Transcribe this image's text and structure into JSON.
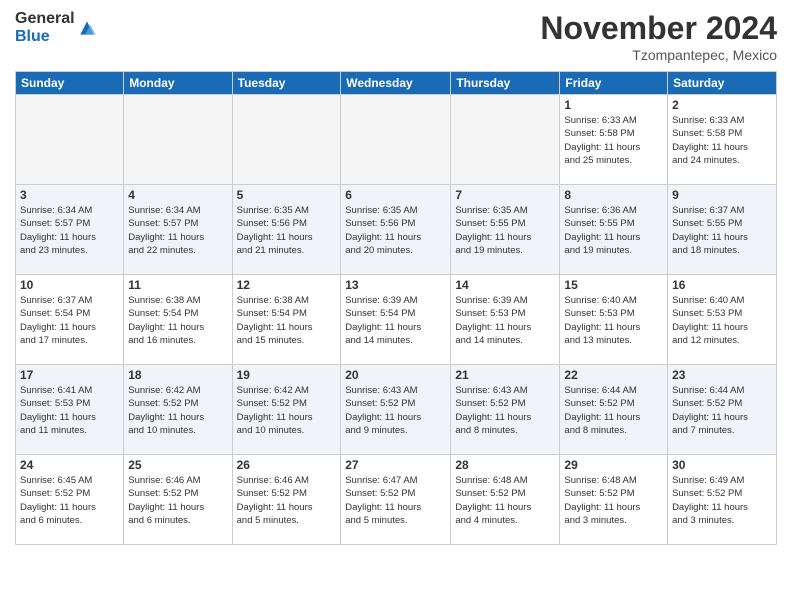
{
  "logo": {
    "general": "General",
    "blue": "Blue"
  },
  "title": "November 2024",
  "location": "Tzompantepec, Mexico",
  "days_header": [
    "Sunday",
    "Monday",
    "Tuesday",
    "Wednesday",
    "Thursday",
    "Friday",
    "Saturday"
  ],
  "weeks": [
    [
      {
        "day": "",
        "info": ""
      },
      {
        "day": "",
        "info": ""
      },
      {
        "day": "",
        "info": ""
      },
      {
        "day": "",
        "info": ""
      },
      {
        "day": "",
        "info": ""
      },
      {
        "day": "1",
        "info": "Sunrise: 6:33 AM\nSunset: 5:58 PM\nDaylight: 11 hours\nand 25 minutes."
      },
      {
        "day": "2",
        "info": "Sunrise: 6:33 AM\nSunset: 5:58 PM\nDaylight: 11 hours\nand 24 minutes."
      }
    ],
    [
      {
        "day": "3",
        "info": "Sunrise: 6:34 AM\nSunset: 5:57 PM\nDaylight: 11 hours\nand 23 minutes."
      },
      {
        "day": "4",
        "info": "Sunrise: 6:34 AM\nSunset: 5:57 PM\nDaylight: 11 hours\nand 22 minutes."
      },
      {
        "day": "5",
        "info": "Sunrise: 6:35 AM\nSunset: 5:56 PM\nDaylight: 11 hours\nand 21 minutes."
      },
      {
        "day": "6",
        "info": "Sunrise: 6:35 AM\nSunset: 5:56 PM\nDaylight: 11 hours\nand 20 minutes."
      },
      {
        "day": "7",
        "info": "Sunrise: 6:35 AM\nSunset: 5:55 PM\nDaylight: 11 hours\nand 19 minutes."
      },
      {
        "day": "8",
        "info": "Sunrise: 6:36 AM\nSunset: 5:55 PM\nDaylight: 11 hours\nand 19 minutes."
      },
      {
        "day": "9",
        "info": "Sunrise: 6:37 AM\nSunset: 5:55 PM\nDaylight: 11 hours\nand 18 minutes."
      }
    ],
    [
      {
        "day": "10",
        "info": "Sunrise: 6:37 AM\nSunset: 5:54 PM\nDaylight: 11 hours\nand 17 minutes."
      },
      {
        "day": "11",
        "info": "Sunrise: 6:38 AM\nSunset: 5:54 PM\nDaylight: 11 hours\nand 16 minutes."
      },
      {
        "day": "12",
        "info": "Sunrise: 6:38 AM\nSunset: 5:54 PM\nDaylight: 11 hours\nand 15 minutes."
      },
      {
        "day": "13",
        "info": "Sunrise: 6:39 AM\nSunset: 5:54 PM\nDaylight: 11 hours\nand 14 minutes."
      },
      {
        "day": "14",
        "info": "Sunrise: 6:39 AM\nSunset: 5:53 PM\nDaylight: 11 hours\nand 14 minutes."
      },
      {
        "day": "15",
        "info": "Sunrise: 6:40 AM\nSunset: 5:53 PM\nDaylight: 11 hours\nand 13 minutes."
      },
      {
        "day": "16",
        "info": "Sunrise: 6:40 AM\nSunset: 5:53 PM\nDaylight: 11 hours\nand 12 minutes."
      }
    ],
    [
      {
        "day": "17",
        "info": "Sunrise: 6:41 AM\nSunset: 5:53 PM\nDaylight: 11 hours\nand 11 minutes."
      },
      {
        "day": "18",
        "info": "Sunrise: 6:42 AM\nSunset: 5:52 PM\nDaylight: 11 hours\nand 10 minutes."
      },
      {
        "day": "19",
        "info": "Sunrise: 6:42 AM\nSunset: 5:52 PM\nDaylight: 11 hours\nand 10 minutes."
      },
      {
        "day": "20",
        "info": "Sunrise: 6:43 AM\nSunset: 5:52 PM\nDaylight: 11 hours\nand 9 minutes."
      },
      {
        "day": "21",
        "info": "Sunrise: 6:43 AM\nSunset: 5:52 PM\nDaylight: 11 hours\nand 8 minutes."
      },
      {
        "day": "22",
        "info": "Sunrise: 6:44 AM\nSunset: 5:52 PM\nDaylight: 11 hours\nand 8 minutes."
      },
      {
        "day": "23",
        "info": "Sunrise: 6:44 AM\nSunset: 5:52 PM\nDaylight: 11 hours\nand 7 minutes."
      }
    ],
    [
      {
        "day": "24",
        "info": "Sunrise: 6:45 AM\nSunset: 5:52 PM\nDaylight: 11 hours\nand 6 minutes."
      },
      {
        "day": "25",
        "info": "Sunrise: 6:46 AM\nSunset: 5:52 PM\nDaylight: 11 hours\nand 6 minutes."
      },
      {
        "day": "26",
        "info": "Sunrise: 6:46 AM\nSunset: 5:52 PM\nDaylight: 11 hours\nand 5 minutes."
      },
      {
        "day": "27",
        "info": "Sunrise: 6:47 AM\nSunset: 5:52 PM\nDaylight: 11 hours\nand 5 minutes."
      },
      {
        "day": "28",
        "info": "Sunrise: 6:48 AM\nSunset: 5:52 PM\nDaylight: 11 hours\nand 4 minutes."
      },
      {
        "day": "29",
        "info": "Sunrise: 6:48 AM\nSunset: 5:52 PM\nDaylight: 11 hours\nand 3 minutes."
      },
      {
        "day": "30",
        "info": "Sunrise: 6:49 AM\nSunset: 5:52 PM\nDaylight: 11 hours\nand 3 minutes."
      }
    ]
  ]
}
